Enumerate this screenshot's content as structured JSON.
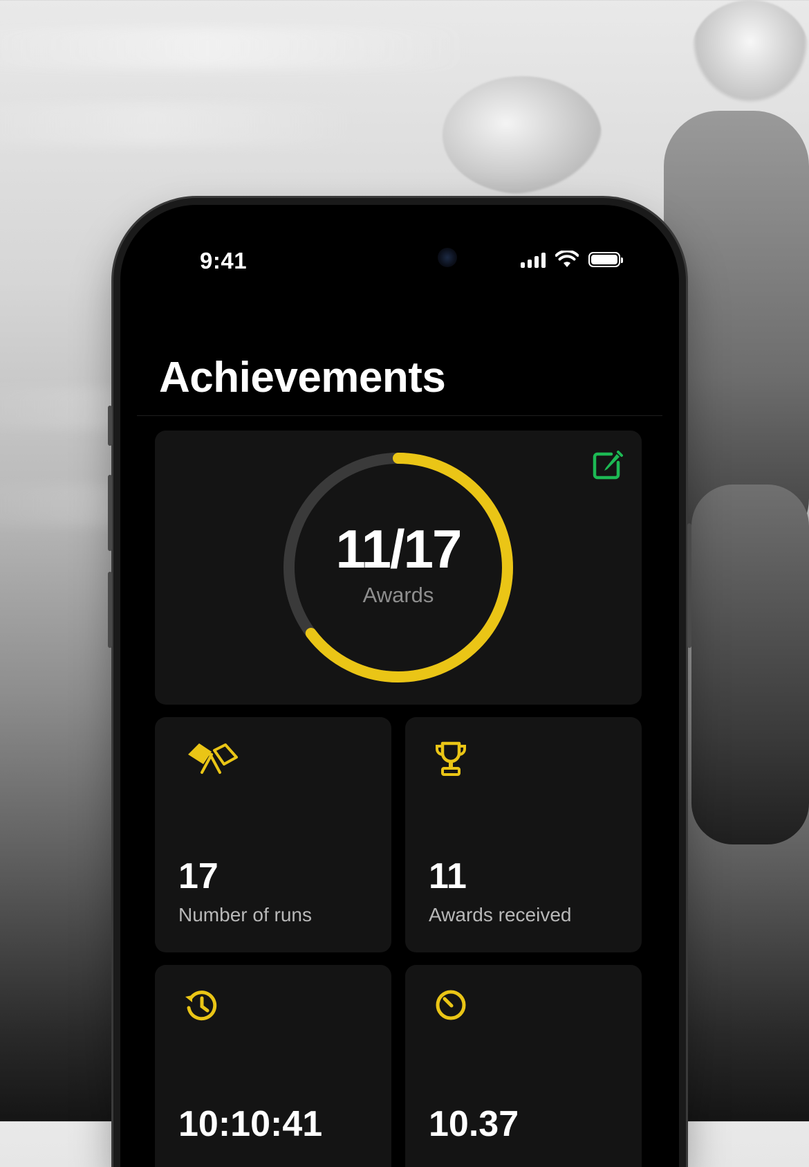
{
  "status_bar": {
    "time": "9:41"
  },
  "page": {
    "title": "Achievements"
  },
  "summary": {
    "awards_count": "11/17",
    "awards_label": "Awards",
    "progress": 0.647
  },
  "stats": [
    {
      "icon": "flags-icon",
      "value": "17",
      "label": "Number of runs"
    },
    {
      "icon": "trophy-icon",
      "value": "11",
      "label": "Awards received"
    },
    {
      "icon": "history-icon",
      "value": "10:10:41",
      "label": ""
    },
    {
      "icon": "timer-icon",
      "value": "10.37",
      "label": ""
    }
  ],
  "colors": {
    "accent": "#EAC516",
    "edit": "#1DB954",
    "card": "#141414",
    "track": "#3a3a3a"
  }
}
